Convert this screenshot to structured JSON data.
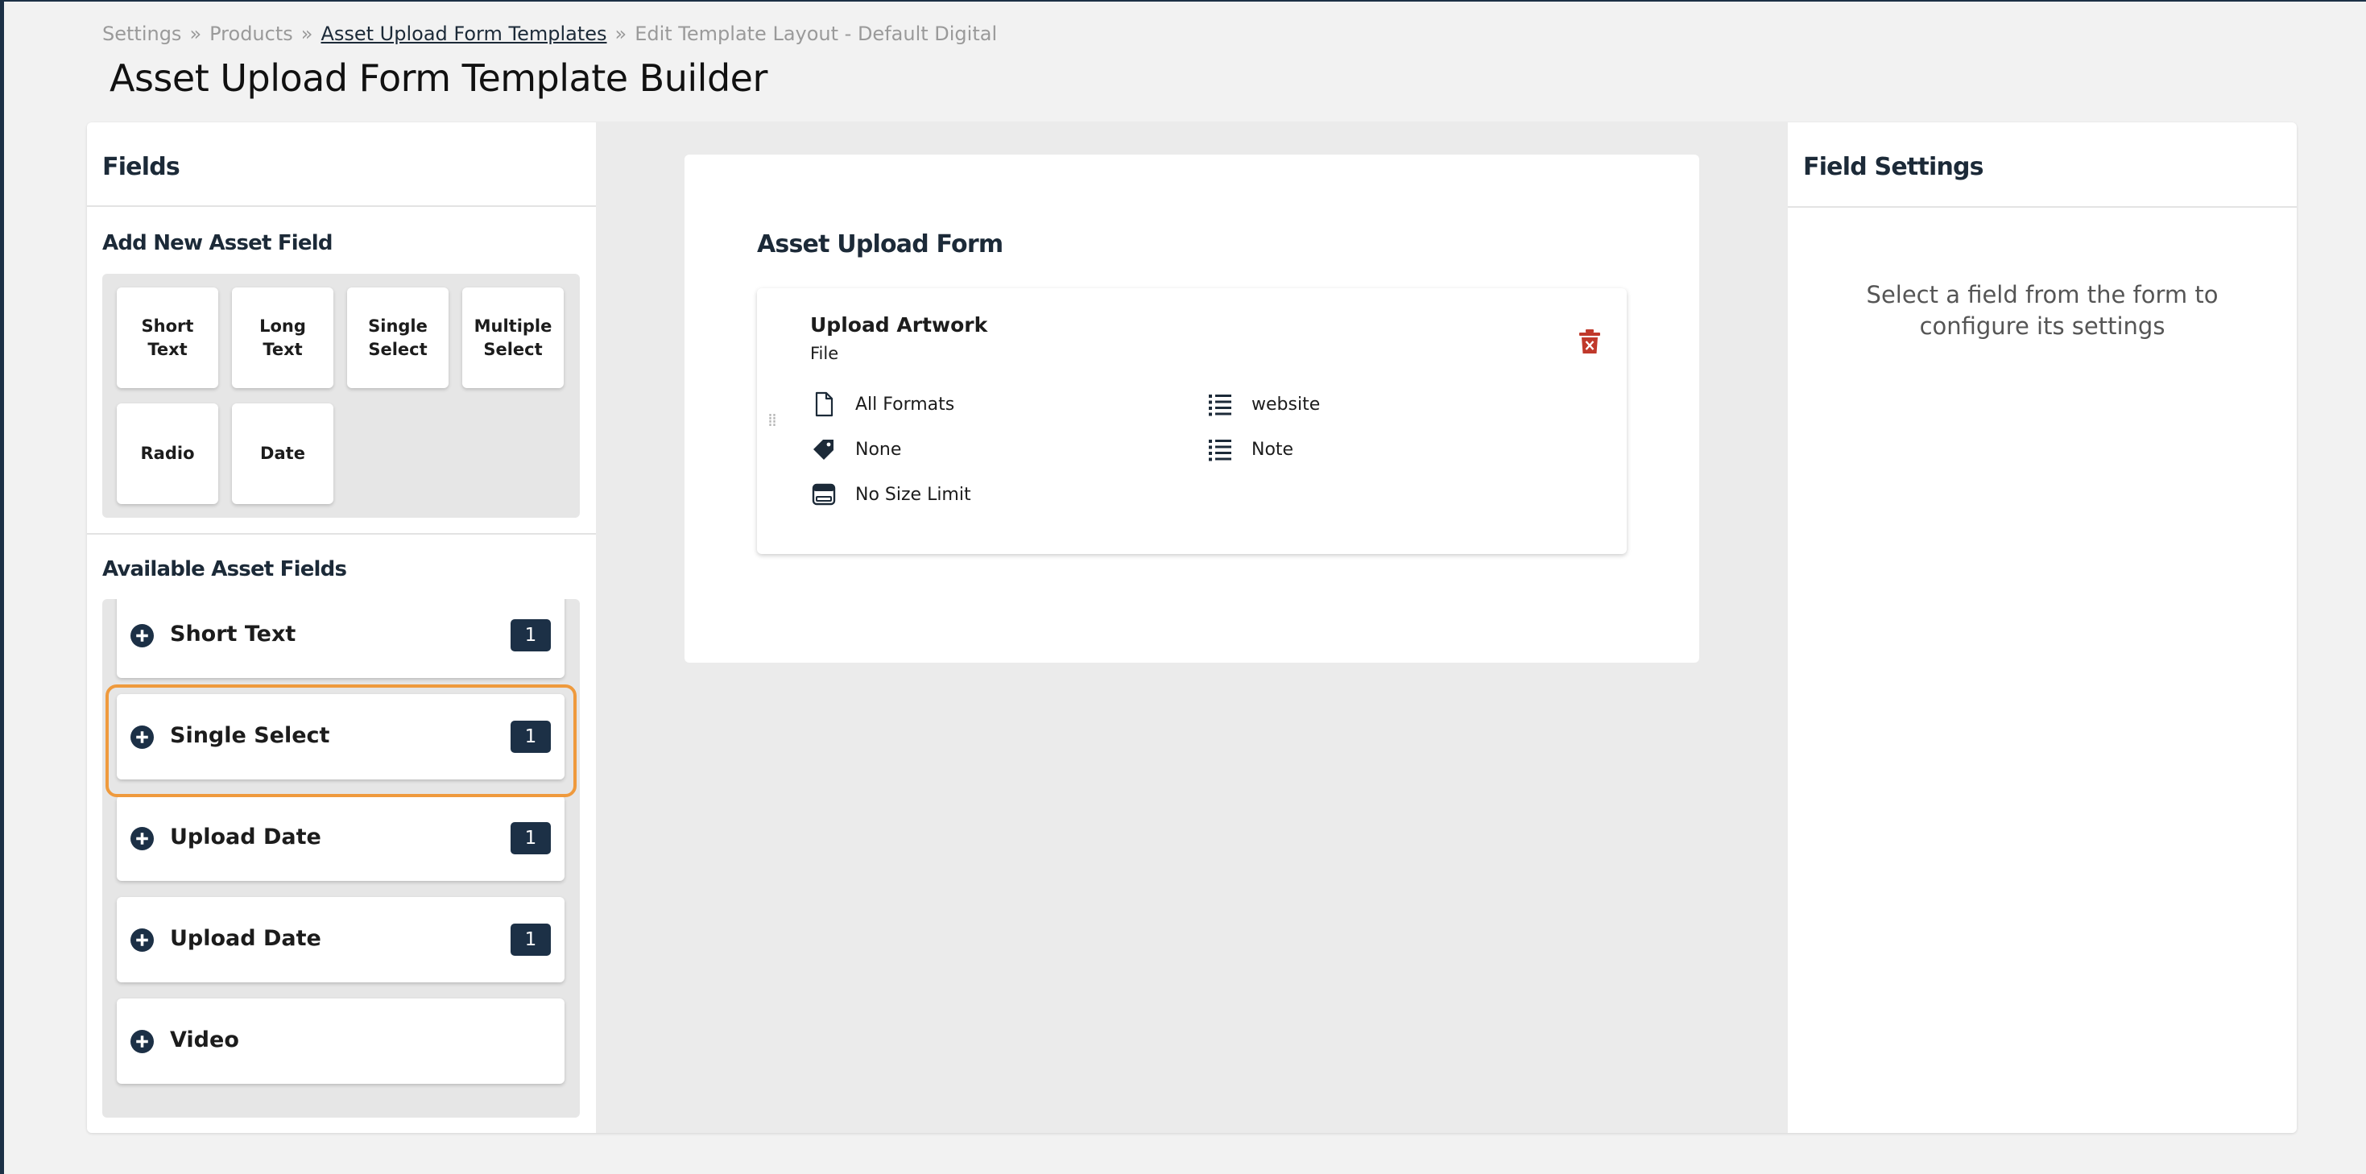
{
  "breadcrumb": {
    "items": [
      "Settings",
      "Products",
      "Asset Upload Form Templates",
      "Edit Template Layout - Default Digital"
    ],
    "separator": "»"
  },
  "page": {
    "title": "Asset Upload Form Template Builder"
  },
  "fields_panel": {
    "heading": "Fields",
    "add_new_heading": "Add New Asset Field",
    "add_tiles": [
      "Short Text",
      "Long Text",
      "Single Select",
      "Multiple Select",
      "Radio",
      "Date"
    ],
    "available_heading": "Available Asset Fields",
    "available_items": [
      {
        "label": "Short Text",
        "count": "1"
      },
      {
        "label": "Single Select",
        "count": "1"
      },
      {
        "label": "Upload Date",
        "count": "1"
      },
      {
        "label": "Upload Date",
        "count": "1"
      },
      {
        "label": "Video",
        "count": ""
      }
    ]
  },
  "form": {
    "title": "Asset Upload Form",
    "field": {
      "name": "Upload Artwork",
      "type": "File",
      "props_left": [
        {
          "icon": "file-icon",
          "text": "All Formats"
        },
        {
          "icon": "tag-icon",
          "text": "None"
        },
        {
          "icon": "storage-icon",
          "text": "No Size Limit"
        }
      ],
      "props_right": [
        {
          "icon": "list-icon",
          "text": "website"
        },
        {
          "icon": "list-icon",
          "text": "Note"
        }
      ]
    }
  },
  "settings_panel": {
    "heading": "Field Settings",
    "hint": "Select a field from the form to configure its settings"
  },
  "colors": {
    "navy": "#1c3046",
    "highlight": "#ef9a3d",
    "delete_red": "#c0392b",
    "background": "#f2f2f2"
  }
}
